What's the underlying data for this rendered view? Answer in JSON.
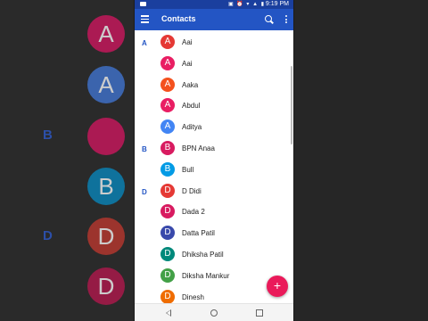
{
  "statusbar": {
    "time": "9:19 PM"
  },
  "appbar": {
    "title": "Contacts"
  },
  "sections": [
    {
      "letter": "A"
    },
    {
      "letter": "B"
    },
    {
      "letter": "D"
    }
  ],
  "contacts": [
    {
      "initial": "A",
      "name": "Aai",
      "color": "#e53935"
    },
    {
      "initial": "A",
      "name": "Aai",
      "color": "#e91e63"
    },
    {
      "initial": "A",
      "name": "Aaka",
      "color": "#f4511e"
    },
    {
      "initial": "A",
      "name": "Abdul",
      "color": "#e91e63"
    },
    {
      "initial": "A",
      "name": "Aditya",
      "color": "#4285f4"
    },
    {
      "initial": "B",
      "name": "BPN Anaa",
      "color": "#d81b60"
    },
    {
      "initial": "B",
      "name": "Bull",
      "color": "#039be5"
    },
    {
      "initial": "D",
      "name": "D Didi",
      "color": "#e53935"
    },
    {
      "initial": "D",
      "name": "Dada 2",
      "color": "#d81b60"
    },
    {
      "initial": "D",
      "name": "Datta Patil",
      "color": "#3949ab"
    },
    {
      "initial": "D",
      "name": "Dhiksha Patil",
      "color": "#00897b"
    },
    {
      "initial": "D",
      "name": "Diksha Mankur",
      "color": "#43a047"
    },
    {
      "initial": "D",
      "name": "Dinesh",
      "color": "#ef6c00"
    }
  ],
  "fab": {
    "label": "+"
  },
  "icons": {
    "menu": "menu-icon",
    "search": "search-icon",
    "more": "more-vert-icon",
    "back": "back-icon",
    "home": "home-icon",
    "recents": "recents-icon"
  },
  "backdrop": {
    "left": [
      {
        "kind": "avatar",
        "initial": "A",
        "color": "#c2185b"
      },
      {
        "kind": "avatar",
        "initial": "A",
        "color": "#3f6fc4"
      },
      {
        "kind": "letter",
        "initial": "B"
      },
      {
        "kind": "avatar",
        "initial": "B",
        "color": "#0b7fb0"
      },
      {
        "kind": "letter",
        "initial": "D"
      },
      {
        "kind": "avatar",
        "initial": "D",
        "color": "#b1362e"
      },
      {
        "kind": "avatar",
        "initial": "D",
        "color": "#a8194a"
      }
    ]
  }
}
